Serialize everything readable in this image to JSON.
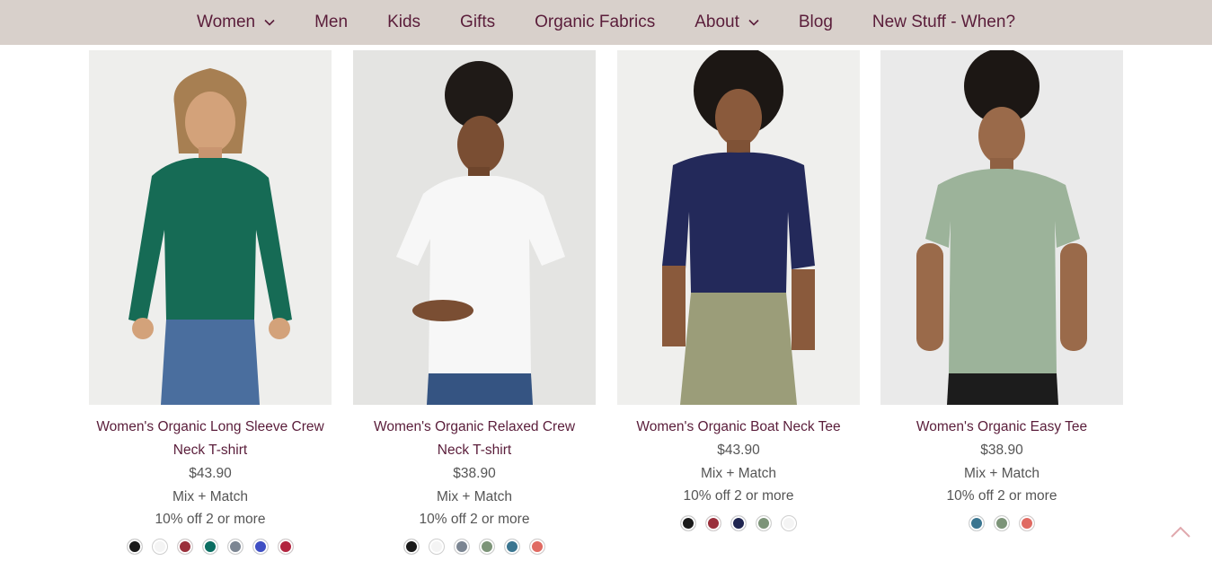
{
  "nav": {
    "items": [
      {
        "label": "Women",
        "dropdown": true
      },
      {
        "label": "Men",
        "dropdown": false
      },
      {
        "label": "Kids",
        "dropdown": false
      },
      {
        "label": "Gifts",
        "dropdown": false
      },
      {
        "label": "Organic Fabrics",
        "dropdown": false
      },
      {
        "label": "About",
        "dropdown": true
      },
      {
        "label": "Blog",
        "dropdown": false
      },
      {
        "label": "New Stuff - When?",
        "dropdown": false
      }
    ],
    "background": "#d8d0cb",
    "text_color": "#5a1d3a"
  },
  "products": [
    {
      "title": "Women's Organic Long Sleeve Crew Neck T-shirt",
      "price": "$43.90",
      "mix": "Mix + Match",
      "promo": "10% off 2 or more",
      "shirt_color": "#166b55",
      "swatches": [
        "#1a1a1a",
        "#f4f4f4",
        "#9a2f3b",
        "#0b6e62",
        "#7b8592",
        "#3f4fc4",
        "#b2243f"
      ]
    },
    {
      "title": "Women's Organic Relaxed Crew Neck T-shirt",
      "price": "$38.90",
      "mix": "Mix + Match",
      "promo": "10% off 2 or more",
      "shirt_color": "#f7f7f7",
      "swatches": [
        "#1a1a1a",
        "#f4f4f4",
        "#7b8592",
        "#7c9478",
        "#3a7590",
        "#e06a62"
      ]
    },
    {
      "title": "Women's Organic Boat Neck Tee",
      "price": "$43.90",
      "mix": "Mix + Match",
      "promo": "10% off 2 or more",
      "shirt_color": "#23295a",
      "swatches": [
        "#1a1a1a",
        "#9a2f3b",
        "#1f2550",
        "#7c9478",
        "#f4f4f4"
      ]
    },
    {
      "title": "Women's Organic Easy Tee",
      "price": "$38.90",
      "mix": "Mix + Match",
      "promo": "10% off 2 or more",
      "shirt_color": "#9cb39a",
      "swatches": [
        "#3a7590",
        "#7c9478",
        "#e06a62"
      ]
    }
  ]
}
